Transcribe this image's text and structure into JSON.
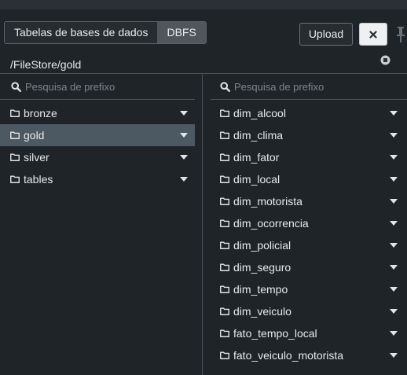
{
  "tabs": {
    "databases_label": "Tabelas de bases de dados",
    "dbfs_label": "DBFS"
  },
  "toolbar": {
    "upload_label": "Upload"
  },
  "path": "/FileStore/gold",
  "left_panel": {
    "search_placeholder": "Pesquisa de prefixo",
    "items": [
      {
        "label": "bronze"
      },
      {
        "label": "gold"
      },
      {
        "label": "silver"
      },
      {
        "label": "tables"
      }
    ],
    "selected": "gold"
  },
  "right_panel": {
    "search_placeholder": "Pesquisa de prefixo",
    "items": [
      {
        "label": "dim_alcool"
      },
      {
        "label": "dim_clima"
      },
      {
        "label": "dim_fator"
      },
      {
        "label": "dim_local"
      },
      {
        "label": "dim_motorista"
      },
      {
        "label": "dim_ocorrencia"
      },
      {
        "label": "dim_policial"
      },
      {
        "label": "dim_seguro"
      },
      {
        "label": "dim_tempo"
      },
      {
        "label": "dim_veiculo"
      },
      {
        "label": "fato_tempo_local"
      },
      {
        "label": "fato_veiculo_motorista"
      }
    ]
  },
  "icons": {
    "folder": "folder-icon",
    "search": "search-icon",
    "caret": "caret-down-icon",
    "close": "close-icon",
    "pin": "pin-icon",
    "info": "info-icon"
  },
  "colors": {
    "background": "#1f2428",
    "selected_row": "#4d5962",
    "divider": "#4a5157",
    "text": "#e8eaec",
    "placeholder": "#7e858b"
  }
}
